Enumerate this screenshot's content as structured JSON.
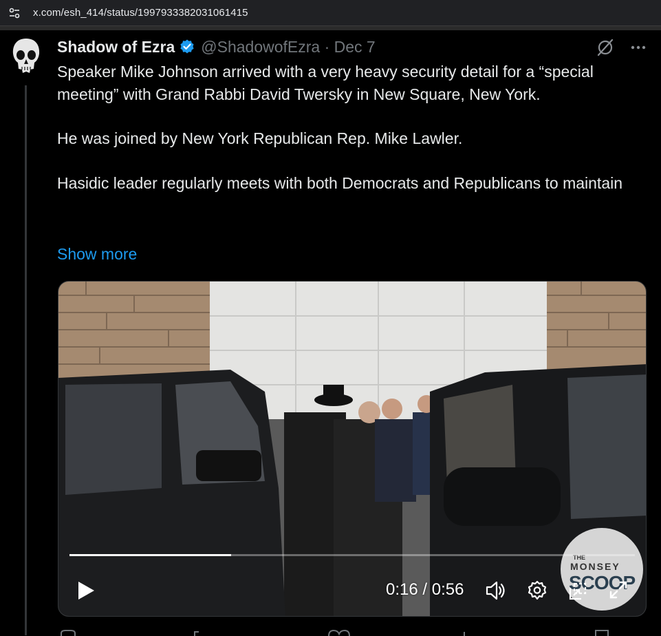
{
  "browser": {
    "url": "x.com/esh_414/status/1997933382031061415",
    "site_info_icon": "site-settings-icon"
  },
  "tweet": {
    "display_name": "Shadow of Ezra",
    "verified_icon": "verified-badge-icon",
    "handle_line": "@ShadowofEzra · Dec 7",
    "paragraphs": [
      "Speaker Mike Johnson arrived with a very heavy security detail for a “special meeting” with Grand Rabbi David Twersky in New Square, New York.",
      "He was joined by New York Republican Rep. Mike Lawler.",
      "Hasidic leader regularly meets with both Democrats and Republicans to maintain"
    ],
    "show_more": "Show more"
  },
  "video": {
    "time": "0:16 / 0:56",
    "progress": 0.286,
    "watermark": {
      "line1": "THE",
      "line2": "MONSEY",
      "line3": "SCOOP"
    }
  },
  "colors": {
    "background": "#000000",
    "text": "#e7e9ea",
    "secondary": "#71767b",
    "link": "#1d9bf0",
    "verified": "#1d9bf0"
  }
}
